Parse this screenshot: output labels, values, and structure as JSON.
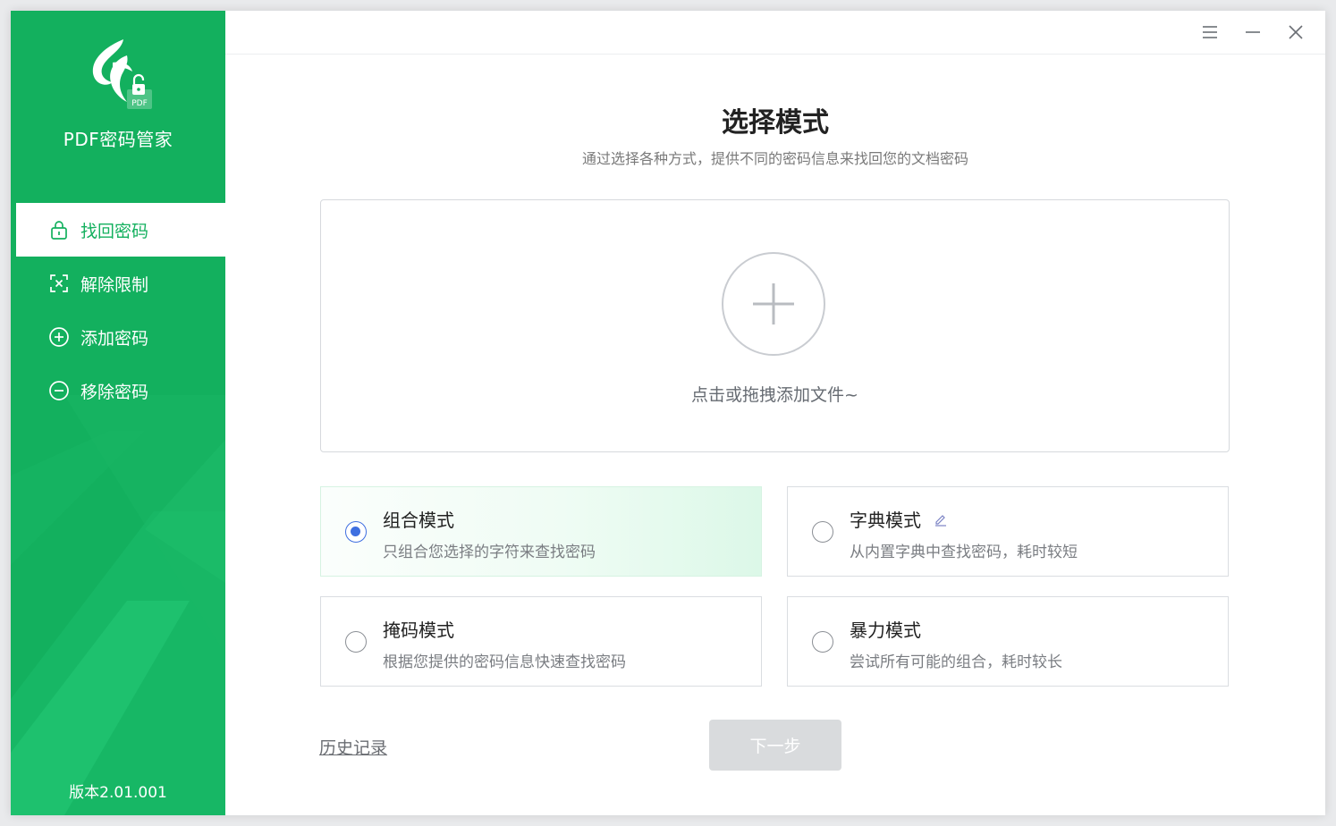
{
  "app": {
    "name": "PDF密码管家",
    "logo_badge": "PDF",
    "version": "版本2.01.001",
    "brand_color": "#13b05e"
  },
  "titlebar": {
    "menu_icon": "menu-icon",
    "minimize_icon": "minimize-icon",
    "close_icon": "close-icon"
  },
  "sidebar": {
    "items": [
      {
        "label": "找回密码",
        "icon": "lock-icon",
        "active": true
      },
      {
        "label": "解除限制",
        "icon": "unrestrict-icon",
        "active": false
      },
      {
        "label": "添加密码",
        "icon": "plus-circle-icon",
        "active": false
      },
      {
        "label": "移除密码",
        "icon": "minus-circle-icon",
        "active": false
      }
    ]
  },
  "main": {
    "title": "选择模式",
    "subtitle": "通过选择各种方式，提供不同的密码信息来找回您的文档密码",
    "dropzone_text": "点击或拖拽添加文件~",
    "modes": [
      {
        "name": "组合模式",
        "desc": "只组合您选择的字符来查找密码",
        "selected": true
      },
      {
        "name": "字典模式",
        "desc": "从内置字典中查找密码，耗时较短",
        "selected": false,
        "editable": true
      },
      {
        "name": "掩码模式",
        "desc": "根据您提供的密码信息快速查找密码",
        "selected": false
      },
      {
        "name": "暴力模式",
        "desc": "尝试所有可能的组合，耗时较长",
        "selected": false
      }
    ],
    "history_label": "历史记录",
    "next_label": "下一步",
    "accent_radio": "#3f6fe0"
  }
}
